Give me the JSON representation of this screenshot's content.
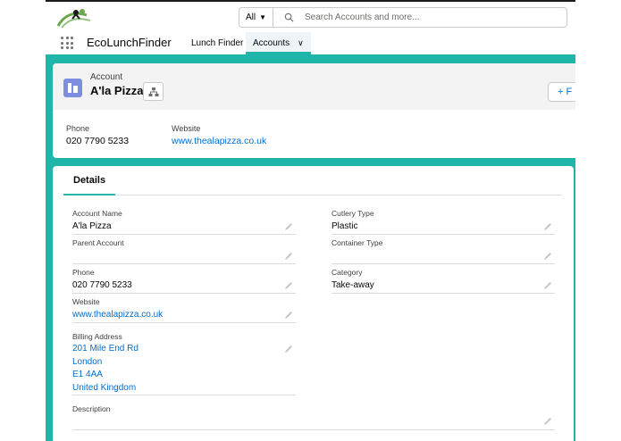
{
  "header": {
    "search_scope": "All",
    "search_placeholder": "Search Accounts and more..."
  },
  "app_nav": {
    "app_name": "EcoLunchFinder",
    "items": [
      {
        "label": "Lunch Finder"
      },
      {
        "label": "Accounts"
      }
    ]
  },
  "record": {
    "object_label": "Account",
    "name": "A'la Pizza",
    "follow_label": "+ F",
    "highlights": [
      {
        "label": "Phone",
        "value": "020 7790 5233"
      },
      {
        "label": "Website",
        "value": "www.thealapizza.co.uk"
      }
    ]
  },
  "details": {
    "tab_label": "Details",
    "left": [
      {
        "label": "Account Name",
        "value": "A'la Pizza"
      },
      {
        "label": "Parent Account",
        "value": ""
      },
      {
        "label": "Phone",
        "value": "020 7790 5233"
      },
      {
        "label": "Website",
        "value": "www.thealapizza.co.uk"
      },
      {
        "label": "Billing Address",
        "lines": [
          "201 Mile End Rd",
          "London",
          "E1 4AA",
          "United Kingdom"
        ]
      },
      {
        "label": "Description",
        "value": ""
      }
    ],
    "right": [
      {
        "label": "Cutlery Type",
        "value": "Plastic"
      },
      {
        "label": "Container Type",
        "value": ""
      },
      {
        "label": "Category",
        "value": "Take-away"
      }
    ]
  },
  "colors": {
    "brand_teal": "#1fb5a8",
    "link": "#006dcc",
    "account_icon": "#7f8de1"
  }
}
